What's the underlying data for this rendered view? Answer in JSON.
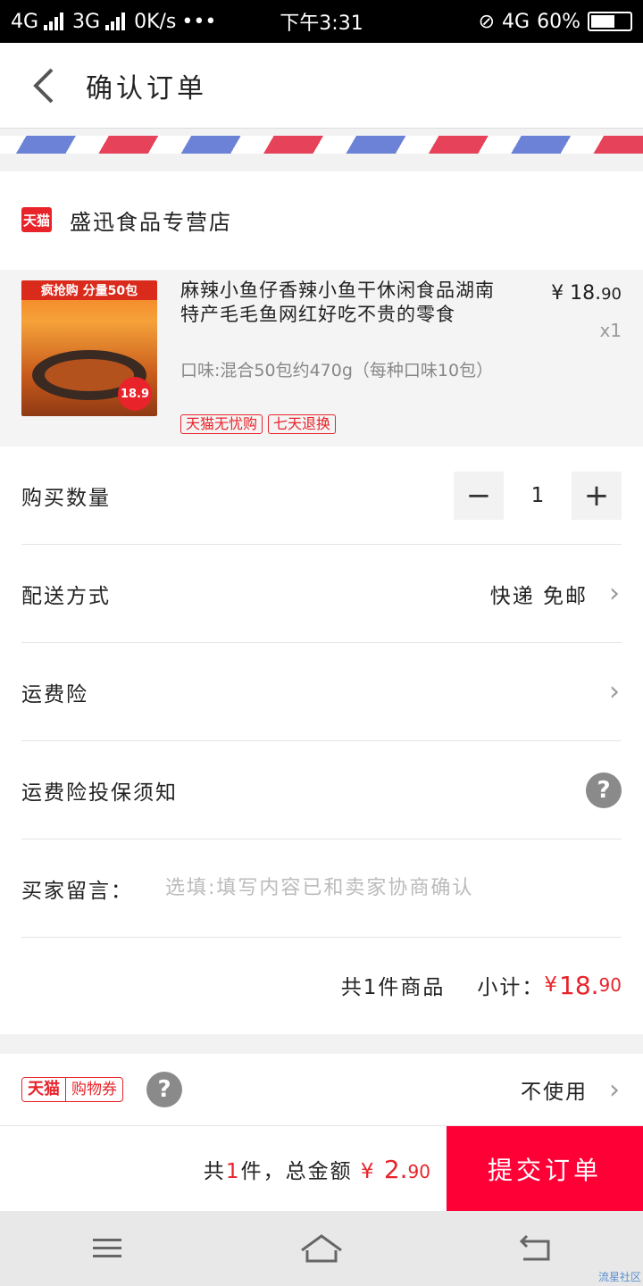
{
  "status_bar": {
    "network_1": "4G",
    "network_2": "3G",
    "speed": "0K/s",
    "dots": "•••",
    "time": "下午3:31",
    "network_3": "4G",
    "battery": "60%"
  },
  "header": {
    "title": "确认订单"
  },
  "store": {
    "logo_text": "天猫",
    "name": "盛迅食品专营店"
  },
  "product": {
    "image_banner": "疯抢购 分量50包",
    "image_price": "18.9",
    "title": "麻辣小鱼仔香辣小鱼干休闲食品湖南特产毛毛鱼网红好吃不贵的零食",
    "spec": "口味:混合50包约470g（每种口味10包）",
    "tags": [
      "天猫无忧购",
      "七天退换"
    ],
    "price_main": "¥ 18.",
    "price_cents": "90",
    "quantity": "x1"
  },
  "quantity_row": {
    "label": "购买数量",
    "minus": "−",
    "value": "1",
    "plus": "+"
  },
  "delivery_row": {
    "label": "配送方式",
    "value": "快递 免邮"
  },
  "insurance_row": {
    "label": "运费险"
  },
  "insurance_notice_row": {
    "label": "运费险投保须知",
    "help": "?"
  },
  "message_row": {
    "label": "买家留言：",
    "placeholder": "选填:填写内容已和卖家协商确认"
  },
  "subtotal": {
    "count_text": "共1件商品",
    "label": "小计：",
    "currency": "¥",
    "amount_main": " 18.",
    "amount_cents": "90"
  },
  "coupon": {
    "badge_a": "天猫",
    "badge_b": "购物券",
    "help": "?",
    "value": "不使用"
  },
  "bottom_bar": {
    "prefix": "共",
    "count": "1",
    "suffix": "件，总金额",
    "currency": " ¥ ",
    "amount_main": "2.",
    "amount_cents": "90",
    "submit": "提交订单"
  },
  "watermark": "流星社区",
  "colors": {
    "accent": "#ff0036",
    "tmall_red": "#e8232a"
  }
}
